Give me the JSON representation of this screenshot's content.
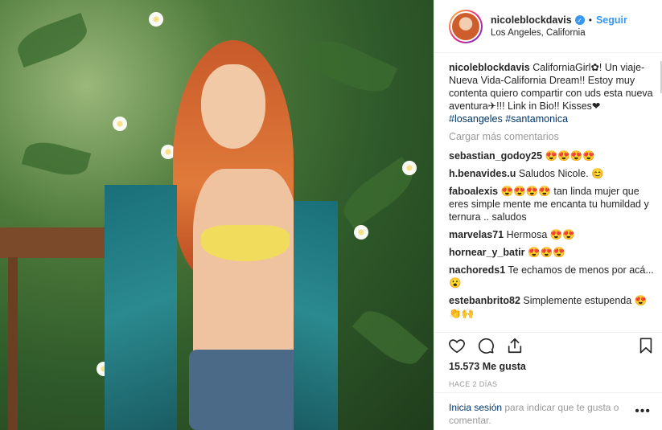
{
  "post": {
    "username": "nicoleblockdavis",
    "verified_icon": "verified-badge-icon",
    "follow_label": "Seguir",
    "location": "Los Angeles, California"
  },
  "caption": {
    "username": "nicoleblockdavis",
    "text": "CaliforniaGirl✿! Un viaje-Nueva Vida-California Dream!! Estoy muy contenta quiero compartir con uds esta nueva aventura✈!!! Link in Bio!! Kisses❤",
    "hashtags": "#losangeles #santamonica"
  },
  "load_more": "Cargar más comentarios",
  "comments": [
    {
      "user": "sebastian_godoy25",
      "text": "😍😍😍😍"
    },
    {
      "user": "h.benavides.u",
      "text": "Saludos Nicole. 😊"
    },
    {
      "user": "faboalexis",
      "text": "😍😍😍😍 tan linda mujer que eres simple mente me encanta tu humildad y ternura .. saludos"
    },
    {
      "user": "marvelas71",
      "text": "Hermosa 😍😍"
    },
    {
      "user": "hornear_y_batir",
      "text": "😍😍😍"
    },
    {
      "user": "nachoreds1",
      "text": "Te echamos de menos por acá...😮"
    },
    {
      "user": "estebanbrito82",
      "text": "Simplemente estupenda 😍👏🙌"
    }
  ],
  "likes": "15.573 Me gusta",
  "time_ago": "HACE 2 DÍAS",
  "footer": {
    "login_label": "Inicia sesión",
    "text": " para indicar que te gusta o comentar."
  },
  "more_label": "•••"
}
